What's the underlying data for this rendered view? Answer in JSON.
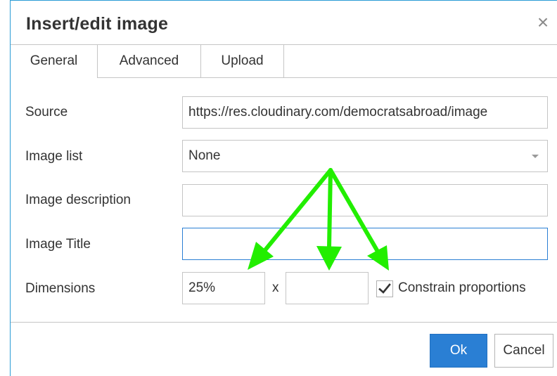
{
  "dialog": {
    "title": "Insert/edit image",
    "close_glyph": "×"
  },
  "tabs": [
    {
      "label": "General",
      "active": true
    },
    {
      "label": "Advanced",
      "active": false
    },
    {
      "label": "Upload",
      "active": false
    }
  ],
  "form": {
    "source": {
      "label": "Source",
      "value": "https://res.cloudinary.com/democratsabroad/image"
    },
    "image_list": {
      "label": "Image list",
      "value": "None"
    },
    "description": {
      "label": "Image description",
      "value": ""
    },
    "title": {
      "label": "Image Title",
      "value": ""
    },
    "dimensions": {
      "label": "Dimensions",
      "width": "25%",
      "height": "",
      "separator": "x",
      "constrain_label": "Constrain proportions",
      "constrain_checked": true
    }
  },
  "buttons": {
    "ok": "Ok",
    "cancel": "Cancel"
  },
  "colors": {
    "accent": "#2a7fd4",
    "dialog_border": "#2a9cd6",
    "annotation_arrows": "#22ee00"
  },
  "icons": {
    "close": "close-icon",
    "dropdown": "chevron-down-icon",
    "check": "checkmark-icon"
  }
}
